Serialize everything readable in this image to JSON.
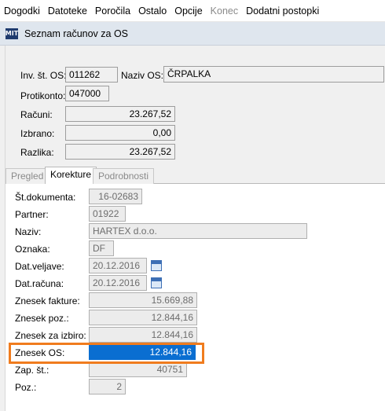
{
  "menu": [
    "Dogodki",
    "Datoteke",
    "Poročila",
    "Ostalo",
    "Opcije",
    "Konec",
    "Dodatni postopki"
  ],
  "window": {
    "title": "Seznam računov za OS",
    "icon": "mit-logo-icon"
  },
  "header": {
    "inv_label": "Inv. št. OS:",
    "inv_value": "011262",
    "naziv_label": "Naziv OS:",
    "naziv_value": "ČRPALKA",
    "protikonto_label": "Protikonto:",
    "protikonto_value": "047000",
    "racuni_label": "Računi:",
    "racuni_value": "23.267,52",
    "izbrano_label": "Izbrano:",
    "izbrano_value": "0,00",
    "razlika_label": "Razlika:",
    "razlika_value": "23.267,52"
  },
  "tabs": [
    {
      "label": "Pregled",
      "active": false
    },
    {
      "label": "Korekture",
      "active": true
    },
    {
      "label": "Podrobnosti",
      "active": false
    }
  ],
  "details": {
    "st_dok_label": "Št.dokumenta:",
    "st_dok_value": "16-02683",
    "partner_label": "Partner:",
    "partner_value": "01922",
    "naziv_label": "Naziv:",
    "naziv_value": "HARTEX d.o.o.",
    "oznaka_label": "Oznaka:",
    "oznaka_value": "DF",
    "dat_veljave_label": "Dat.veljave:",
    "dat_veljave_value": "20.12.2016",
    "dat_racuna_label": "Dat.računa:",
    "dat_racuna_value": "20.12.2016",
    "znesek_fakture_label": "Znesek fakture:",
    "znesek_fakture_value": "15.669,88",
    "znesek_poz_label": "Znesek poz.:",
    "znesek_poz_value": "12.844,16",
    "znesek_izbiro_label": "Znesek za izbiro:",
    "znesek_izbiro_value": "12.844,16",
    "znesek_os_label": "Znesek OS:",
    "znesek_os_value": "12.844,16",
    "zap_st_label": "Zap. št.:",
    "zap_st_value": "40751",
    "poz_label": "Poz.:",
    "poz_value": "2"
  },
  "colors": {
    "highlight": "#f07c1e",
    "selection": "#0a6ed1"
  }
}
